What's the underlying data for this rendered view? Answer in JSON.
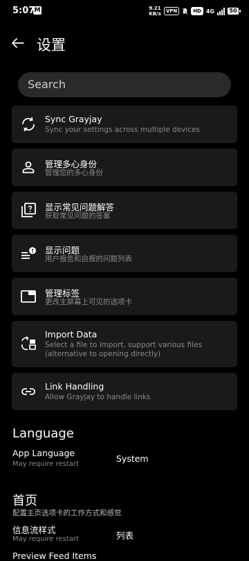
{
  "status_bar": {
    "time": "5:07",
    "notification": "M",
    "speed_value": "9.21",
    "speed_unit": "KB/s",
    "vpn": "VPN",
    "hd": "HD",
    "network": "4G",
    "battery": "50"
  },
  "header": {
    "title": "设置"
  },
  "search": {
    "placeholder": "Search"
  },
  "cards": [
    {
      "icon": "sync-icon",
      "title": "Sync Grayjay",
      "desc": "Sync your settings across multiple devices"
    },
    {
      "icon": "person-icon",
      "title": "管理多心身份",
      "desc": "管理您的多心身份"
    },
    {
      "icon": "faq-icon",
      "title": "显示常见问题解答",
      "desc": "获取常见问题的答案"
    },
    {
      "icon": "issues-icon",
      "title": "显示问题",
      "desc": "用户报告和自报的问题列表"
    },
    {
      "icon": "tabs-icon",
      "title": "管理标签",
      "desc": "更改主屏幕上可见的选项卡"
    },
    {
      "icon": "import-icon",
      "title": "Import Data",
      "desc": "Select a file to import, support various files (alternative to opening directly)"
    },
    {
      "icon": "link-icon",
      "title": "Link Handling",
      "desc": "Allow Grayjay to handle links"
    }
  ],
  "language": {
    "title": "Language",
    "app_language_label": "App Language",
    "app_language_sub": "May require restart",
    "app_language_value": "System"
  },
  "home": {
    "title": "首页",
    "desc": "配置主页选项卡的工作方式和感觉",
    "feed_label": "信息流样式",
    "feed_sub": "May require restart",
    "feed_value": "列表",
    "next_label": "Preview Feed Items"
  }
}
